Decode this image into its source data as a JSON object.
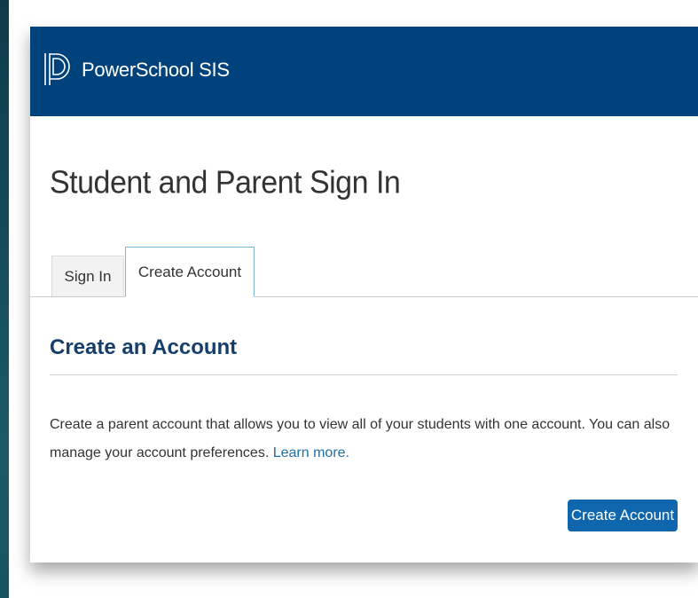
{
  "header": {
    "brand": "PowerSchool SIS",
    "logo_icon": "powerschool-p-icon",
    "background_color": "#00427c"
  },
  "page": {
    "title": "Student and Parent Sign In"
  },
  "tabs": [
    {
      "label": "Sign In",
      "active": false
    },
    {
      "label": "Create Account",
      "active": true
    }
  ],
  "section": {
    "title": "Create an Account",
    "description": "Create a parent account that allows you to view all of your students with one account. You can also manage your account preferences.",
    "link_label": "Learn more.",
    "button_label": "Create Account",
    "accent_color": "#0f66ad",
    "link_color": "#1e6fa8"
  }
}
